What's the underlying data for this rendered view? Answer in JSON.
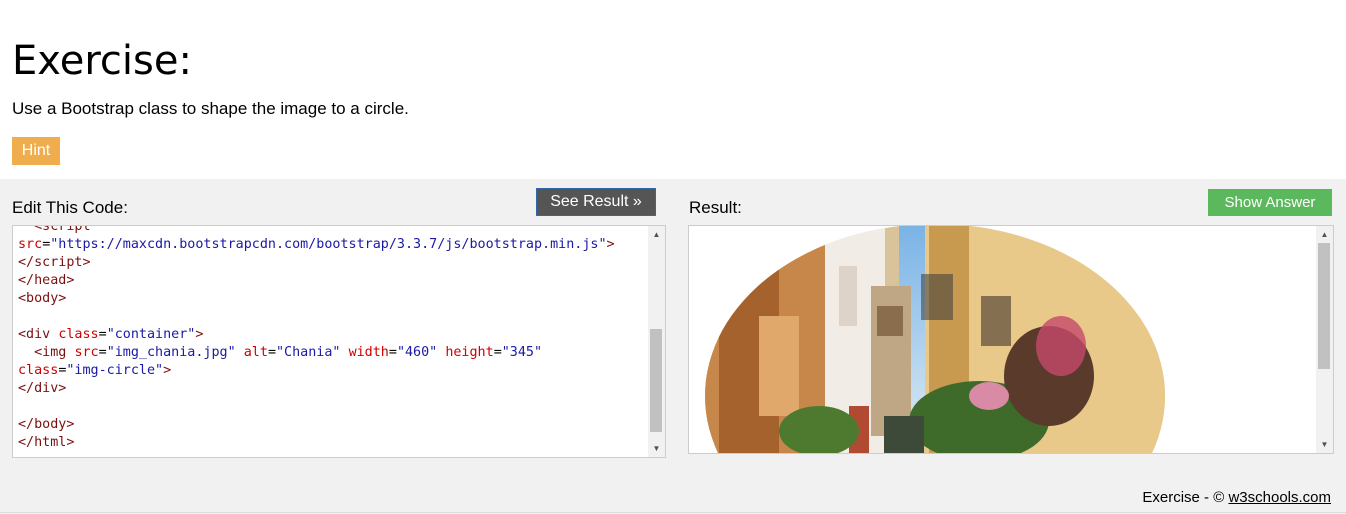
{
  "heading": "Exercise:",
  "instruction": "Use a Bootstrap class to shape the image to a circle.",
  "hint_label": "Hint",
  "editor": {
    "label": "Edit This Code:",
    "see_result_label": "See Result »"
  },
  "result": {
    "label": "Result:",
    "show_answer_label": "Show Answer",
    "image_alt": "Chania"
  },
  "footer": {
    "prefix": "Exercise - ©",
    "link": "w3schools.com"
  },
  "colors": {
    "hint": "#f0ad4e",
    "see_result": "#555555",
    "show_answer": "#5cb85c",
    "panel_bg": "#f1f1f1"
  }
}
